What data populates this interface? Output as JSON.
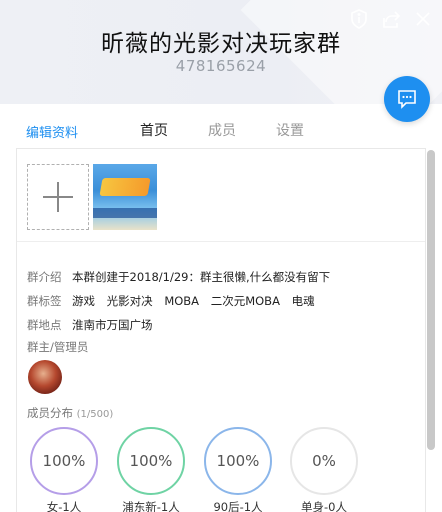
{
  "header": {
    "title": "昕薇的光影对决玩家群",
    "group_id": "478165624"
  },
  "nav": {
    "edit_label": "编辑资料",
    "tabs": [
      {
        "label": "首页",
        "active": true
      },
      {
        "label": "成员",
        "active": false
      },
      {
        "label": "设置",
        "active": false
      }
    ]
  },
  "info": {
    "intro_label": "群介绍",
    "intro_text": "本群创建于2018/1/29：群主很懒,什么都没有留下",
    "tags_label": "群标签",
    "tags": [
      "游戏",
      "光影对决",
      "MOBA",
      "二次元MOBA",
      "电魂"
    ],
    "location_label": "群地点",
    "location": "淮南市万国广场",
    "admins_label": "群主/管理员"
  },
  "distribution": {
    "title": "成员分布",
    "count": "(1/500)",
    "items": [
      {
        "value": "100%",
        "label": "女-1人",
        "color": "#b59ee8"
      },
      {
        "value": "100%",
        "label": "浦东新-1人",
        "color": "#6fd3a4"
      },
      {
        "value": "100%",
        "label": "90后-1人",
        "color": "#8bb6ea"
      },
      {
        "value": "0%",
        "label": "单身-0人",
        "color": "#e6e6e6"
      }
    ]
  },
  "colors": {
    "accent": "#1e8ff0"
  },
  "icons": {
    "report": "shield-info-icon",
    "share": "share-icon",
    "close": "close-icon",
    "chat": "chat-bubble-icon",
    "add": "plus-icon"
  }
}
